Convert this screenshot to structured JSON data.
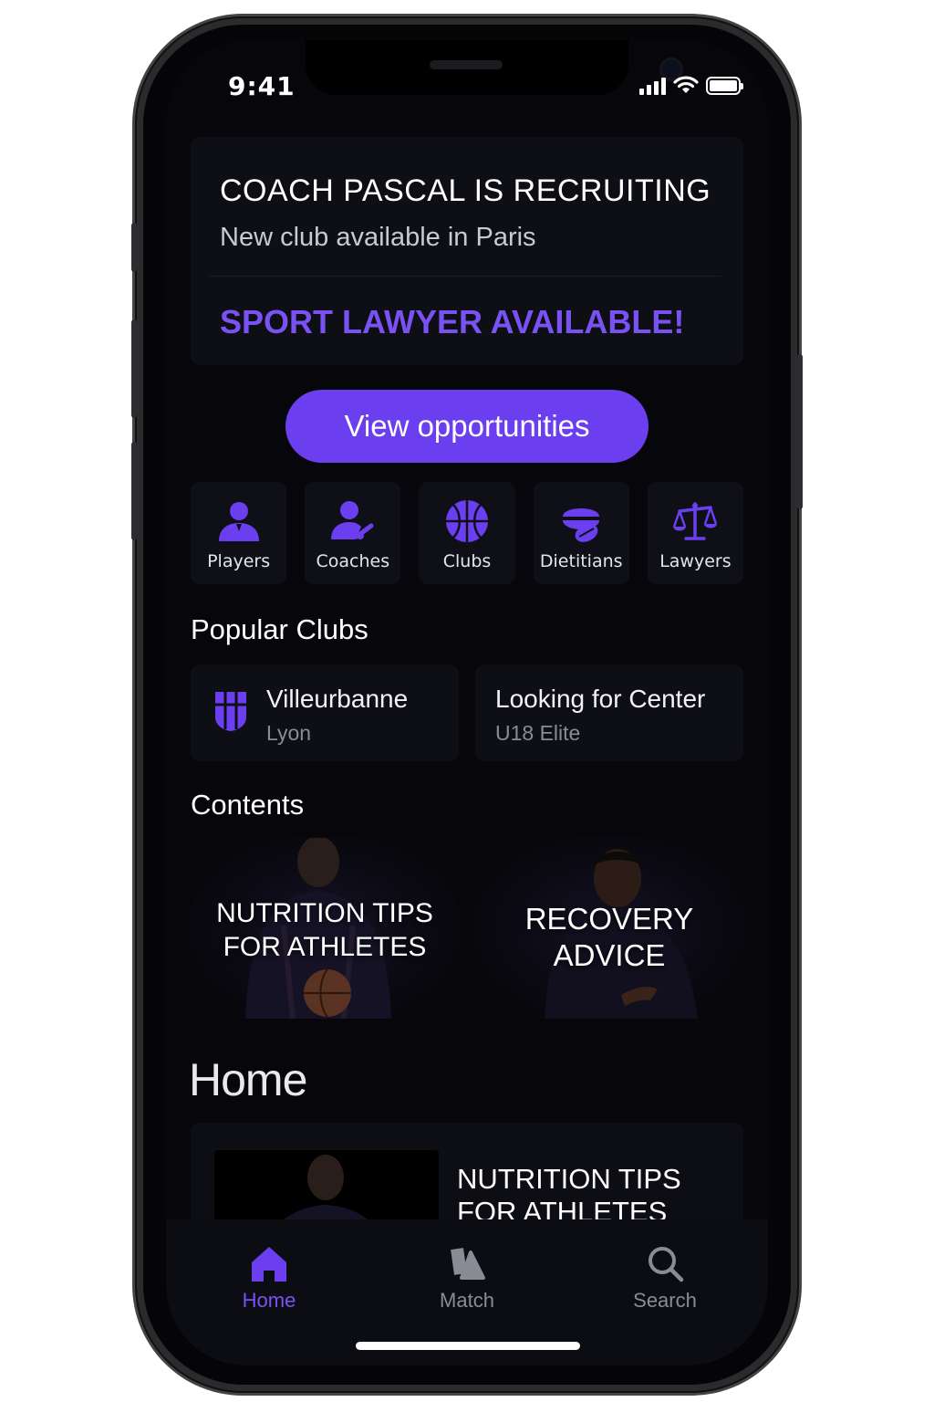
{
  "status_bar": {
    "time": "9:41"
  },
  "promo": {
    "title": "COACH PASCAL IS RECRUITING",
    "subtitle": "New club available in Paris",
    "alert": "SPORT LAWYER AVAILABLE!"
  },
  "cta": {
    "label": "View opportunities"
  },
  "categories": [
    {
      "label": "Players",
      "icon": "player-icon"
    },
    {
      "label": "Coaches",
      "icon": "coach-icon"
    },
    {
      "label": "Clubs",
      "icon": "basketball-icon"
    },
    {
      "label": "Dietitians",
      "icon": "food-icon"
    },
    {
      "label": "Lawyers",
      "icon": "scales-icon"
    }
  ],
  "popular_clubs": {
    "title": "Popular Clubs",
    "items": [
      {
        "name": "Villeurbanne",
        "sub": "Lyon",
        "icon": "club-crest-icon"
      },
      {
        "name": "Looking for Center",
        "sub": "U18 Elite"
      }
    ]
  },
  "contents": {
    "title": "Contents",
    "items": [
      {
        "line1": "NUTRITION TIPS",
        "line2": "FOR ATHLETES"
      },
      {
        "line1": "RECOVERY",
        "line2": "ADVICE"
      }
    ]
  },
  "home": {
    "heading": "Home",
    "feed": [
      {
        "line1": "NUTRITION TIPS",
        "line2": "FOR ATHLETES"
      }
    ]
  },
  "tab_bar": {
    "items": [
      {
        "label": "Home",
        "icon": "home-icon",
        "active": true
      },
      {
        "label": "Match",
        "icon": "match-icon",
        "active": false
      },
      {
        "label": "Search",
        "icon": "search-icon",
        "active": false
      }
    ]
  },
  "colors": {
    "accent": "#6b3ff0",
    "accent_text": "#7a52f4",
    "background": "#07070b",
    "card": "#0e0e15",
    "inactive": "#8b8b96"
  }
}
